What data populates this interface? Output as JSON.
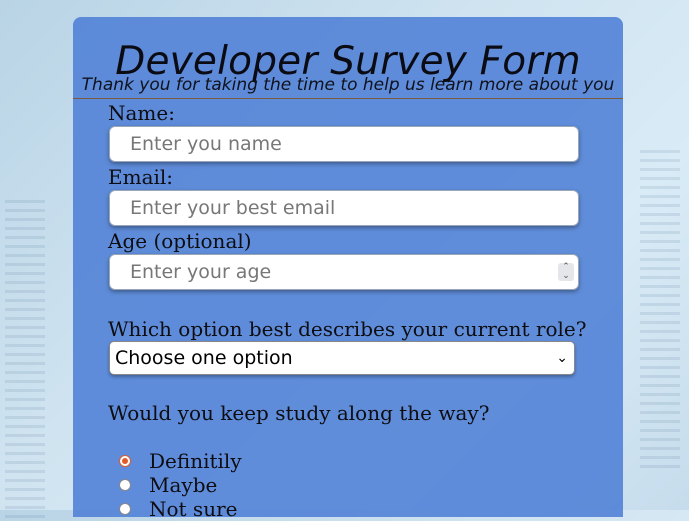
{
  "form": {
    "title": "Developer Survey Form",
    "subtitle": "Thank you for taking the time to help us learn more about you",
    "name_label": "Name:",
    "name_placeholder": "Enter you name",
    "email_label": "Email:",
    "email_placeholder": "Enter your best email",
    "age_label": "Age (optional)",
    "age_placeholder": "Enter your age",
    "role_question": "Which option best describes your current role?",
    "role_selected": "Choose one option",
    "study_question": "Would you keep study along the way?",
    "study_options": [
      {
        "label": "Definitily",
        "checked": true
      },
      {
        "label": "Maybe",
        "checked": false
      },
      {
        "label": "Not sure",
        "checked": false
      }
    ]
  },
  "colors": {
    "card": "#4e80d6",
    "radio_selected": "#e05a2a"
  }
}
